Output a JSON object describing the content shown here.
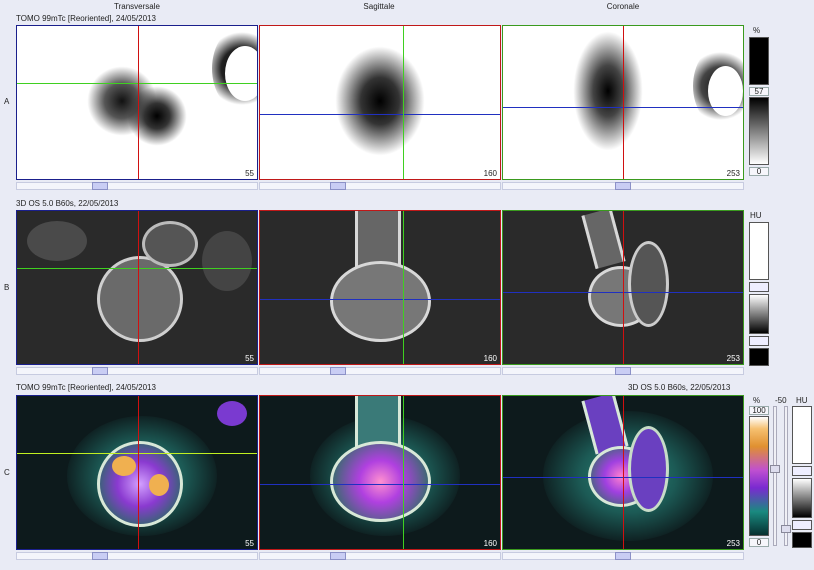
{
  "columns": {
    "transversale": "Transversale",
    "sagittale": "Sagittale",
    "coronale": "Coronale"
  },
  "rows": {
    "a": "A",
    "b": "B",
    "c": "C"
  },
  "series": {
    "a": "TOMO 99mTc [Reoriented], 24/05/2013",
    "b": "3D OS 5.0 B60s, 22/05/2013",
    "c_left": "TOMO 99mTc [Reoriented], 24/05/2013",
    "c_right": "3D OS 5.0 B60s, 22/05/2013"
  },
  "slices": {
    "transversale": "55",
    "sagittale": "160",
    "coronale": "253"
  },
  "colorbars": {
    "a": {
      "unit": "%",
      "value": "57",
      "min": "0"
    },
    "b": {
      "unit": "HU"
    },
    "c_pet": {
      "unit": "%",
      "max": "100",
      "min": "0"
    },
    "c_ct": {
      "unit": "HU",
      "value": "-50"
    }
  },
  "colors": {
    "transversale_border": "#1a1f8c",
    "sagittale_border": "#c01818",
    "coronale_border": "#3a9a1e",
    "crosshair_red": "#d01010",
    "crosshair_green": "#3fd020",
    "crosshair_blue": "#2030c0"
  }
}
